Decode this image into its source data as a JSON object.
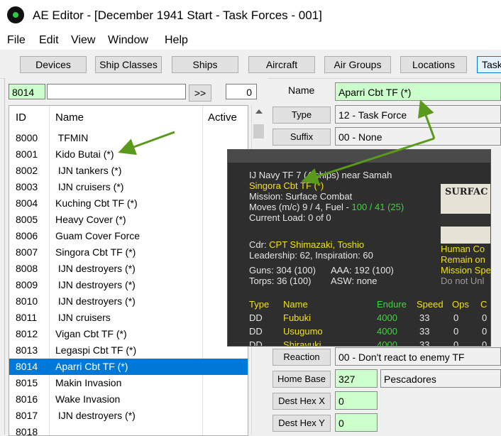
{
  "window": {
    "title": "AE Editor - [December 1941 Start - Task Forces - 001]"
  },
  "menu": [
    "File",
    "Edit",
    "View",
    "Window",
    "Help"
  ],
  "toolbar": {
    "buttons": [
      "Devices",
      "Ship Classes",
      "Ships",
      "Aircraft",
      "Air Groups",
      "Locations",
      "Task"
    ]
  },
  "search": {
    "id_value": "8014",
    "name_value": "",
    "go_label": ">>",
    "count": "0"
  },
  "list": {
    "headers": {
      "id": "ID",
      "name": "Name",
      "active": "Active"
    },
    "rows": [
      {
        "id": "8000",
        "name": " TFMIN"
      },
      {
        "id": "8001",
        "name": "Kido Butai (*)"
      },
      {
        "id": "8002",
        "name": " IJN tankers (*)"
      },
      {
        "id": "8003",
        "name": " IJN cruisers (*)"
      },
      {
        "id": "8004",
        "name": "Kuching Cbt TF (*)"
      },
      {
        "id": "8005",
        "name": "Heavy Cover (*)"
      },
      {
        "id": "8006",
        "name": "Guam Cover Force"
      },
      {
        "id": "8007",
        "name": "Singora Cbt TF (*)"
      },
      {
        "id": "8008",
        "name": " IJN destroyers (*)"
      },
      {
        "id": "8009",
        "name": " IJN destroyers (*)"
      },
      {
        "id": "8010",
        "name": " IJN destroyers (*)"
      },
      {
        "id": "8011",
        "name": " IJN cruisers"
      },
      {
        "id": "8012",
        "name": "Vigan Cbt TF (*)"
      },
      {
        "id": "8013",
        "name": "Legaspi Cbt TF (*)"
      },
      {
        "id": "8014",
        "name": "Aparri Cbt TF (*)"
      },
      {
        "id": "8015",
        "name": "Makin Invasion"
      },
      {
        "id": "8016",
        "name": "Wake Invasion"
      },
      {
        "id": "8017",
        "name": " IJN destroyers (*)"
      },
      {
        "id": "8018",
        "name": ""
      }
    ],
    "selected_id": "8014"
  },
  "form": {
    "name_label": "Name",
    "name_value": "Aparri Cbt TF (*)",
    "type_label": "Type",
    "type_value": "12 - Task Force",
    "suffix_label": "Suffix",
    "suffix_value": "00 - None",
    "reaction_label": "Reaction",
    "reaction_value": "00 - Don't react to enemy TF",
    "homebase_label": "Home Base",
    "homebase_id": "327",
    "homebase_name": "Pescadores",
    "desthexx_label": "Dest Hex X",
    "desthexx_value": "0",
    "desthexy_label": "Dest Hex Y",
    "desthexy_value": "0"
  },
  "overlay": {
    "line1": "IJ Navy TF 7 (4 ships) near Samah",
    "tf_name": "Singora Cbt TF (*)",
    "mission": "Mission: Surface Combat",
    "moves_prefix": "Moves (m/c) 9 / 4, Fuel - ",
    "moves_fuel": "100 / 41 (25)",
    "load": "Current Load: 0 of 0",
    "cdr_label": "Cdr: ",
    "cdr_name": "CPT Shimazaki, Toshio",
    "leadership": "Leadership: 62, Inspiration: 60",
    "guns": "Guns: 304 (100)",
    "aaa": "AAA: 192 (100)",
    "torps": "Torps: 36 (100)",
    "asw": "ASW: none",
    "table_headers": [
      "Type",
      "Name",
      "Endure",
      "Speed",
      "Ops",
      "C"
    ],
    "ships": [
      {
        "type": "DD",
        "name": "Fubuki",
        "endure": "4000",
        "speed": "33",
        "ops": "0",
        "c": "0"
      },
      {
        "type": "DD",
        "name": "Usugumo",
        "endure": "4000",
        "speed": "33",
        "ops": "0",
        "c": "0"
      },
      {
        "type": "DD",
        "name": "Shirayuki",
        "endure": "4000",
        "speed": "33",
        "ops": "0",
        "c": "0"
      }
    ],
    "photo_title": "SURFAC",
    "side_lines": [
      "Human Co",
      "Remain on",
      "Mission Spe",
      "Do not Unl"
    ]
  },
  "colors": {
    "accent_green": "#5a9a1a",
    "selection": "#0078d7",
    "overlay_yellow": "#f0e020",
    "overlay_green": "#3fd53f"
  }
}
